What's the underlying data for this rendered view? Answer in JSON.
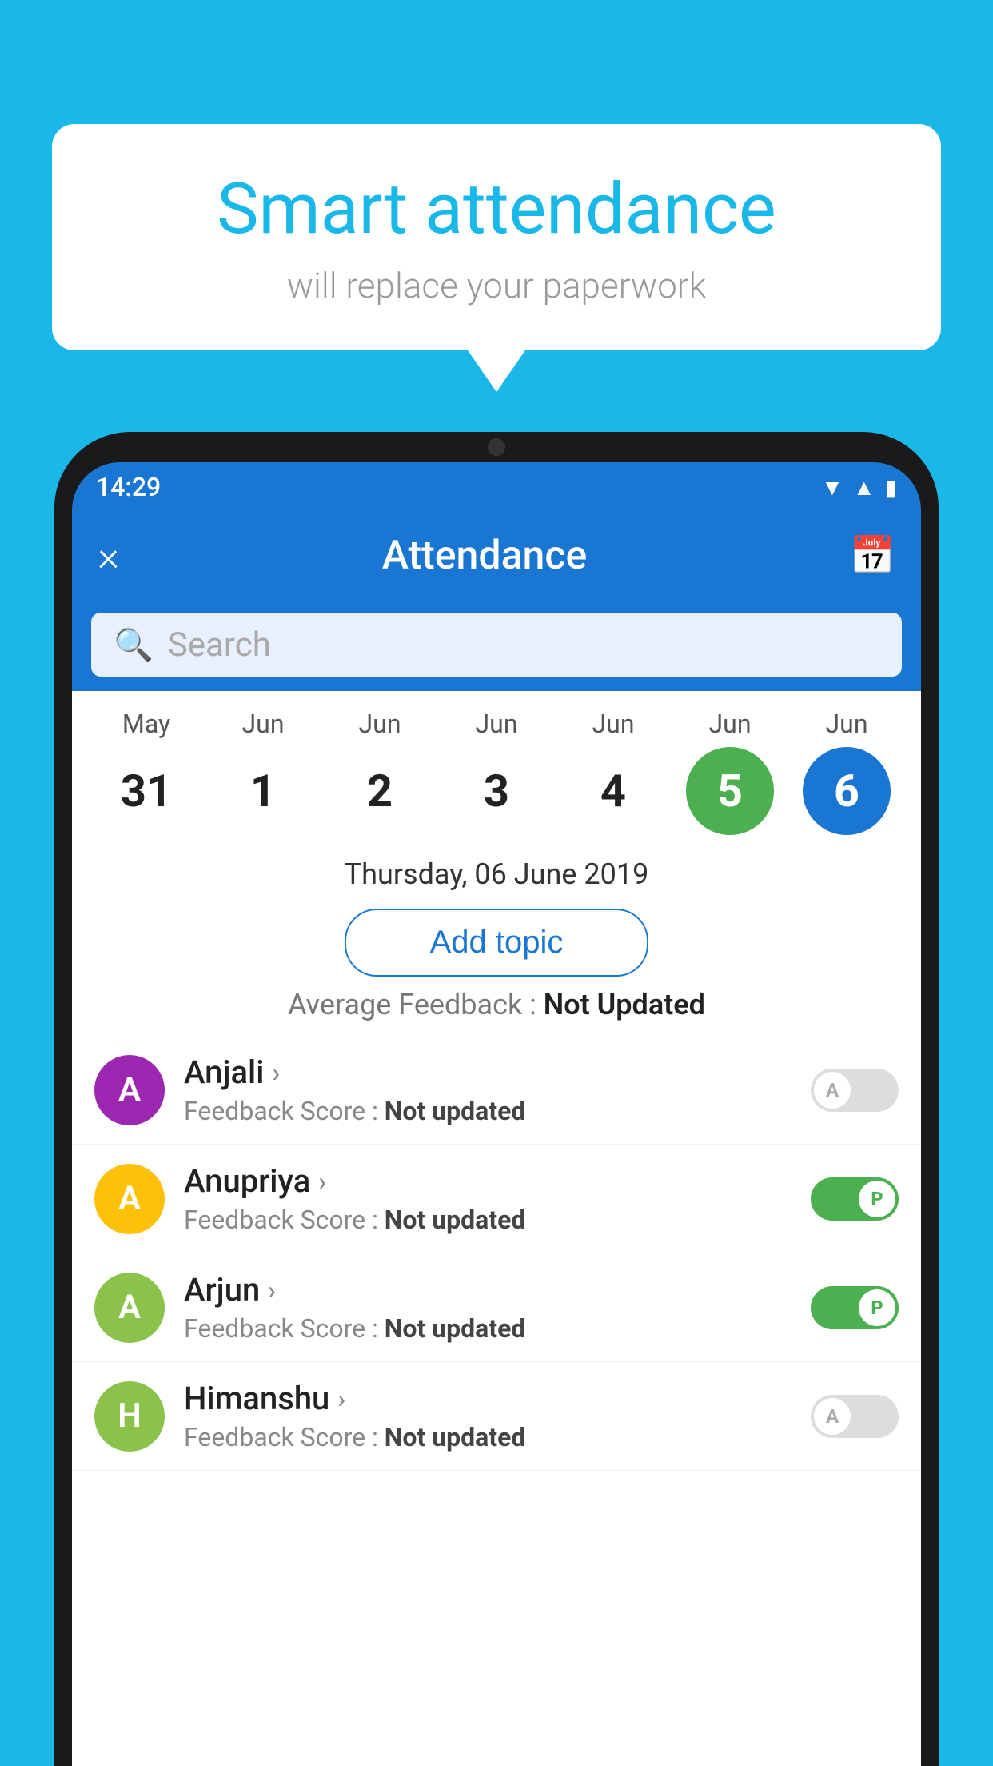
{
  "background_color": "#1ab8e8",
  "bubble": {
    "title": "Smart attendance",
    "subtitle": "will replace your paperwork"
  },
  "status_bar": {
    "time": "14:29",
    "icons": [
      "wifi",
      "signal",
      "battery"
    ]
  },
  "toolbar": {
    "close_label": "×",
    "title": "Attendance",
    "calendar_icon": "📅"
  },
  "search": {
    "placeholder": "Search"
  },
  "calendar": {
    "days": [
      {
        "month": "May",
        "date": "31",
        "state": "normal"
      },
      {
        "month": "Jun",
        "date": "1",
        "state": "normal"
      },
      {
        "month": "Jun",
        "date": "2",
        "state": "normal"
      },
      {
        "month": "Jun",
        "date": "3",
        "state": "normal"
      },
      {
        "month": "Jun",
        "date": "4",
        "state": "normal"
      },
      {
        "month": "Jun",
        "date": "5",
        "state": "today"
      },
      {
        "month": "Jun",
        "date": "6",
        "state": "selected"
      }
    ]
  },
  "selected_date_label": "Thursday, 06 June 2019",
  "add_topic_label": "Add topic",
  "avg_feedback_label": "Average Feedback :",
  "avg_feedback_value": "Not Updated",
  "students": [
    {
      "name": "Anjali",
      "avatar_letter": "A",
      "avatar_color": "#9c27b0",
      "feedback_label": "Feedback Score :",
      "feedback_value": "Not updated",
      "toggle": "off",
      "toggle_letter": "A"
    },
    {
      "name": "Anupriya",
      "avatar_letter": "A",
      "avatar_color": "#ffc107",
      "feedback_label": "Feedback Score :",
      "feedback_value": "Not updated",
      "toggle": "on",
      "toggle_letter": "P"
    },
    {
      "name": "Arjun",
      "avatar_letter": "A",
      "avatar_color": "#8bc34a",
      "feedback_label": "Feedback Score :",
      "feedback_value": "Not updated",
      "toggle": "on",
      "toggle_letter": "P"
    },
    {
      "name": "Himanshu",
      "avatar_letter": "H",
      "avatar_color": "#8bc34a",
      "feedback_label": "Feedback Score :",
      "feedback_value": "Not updated",
      "toggle": "off",
      "toggle_letter": "A"
    }
  ]
}
